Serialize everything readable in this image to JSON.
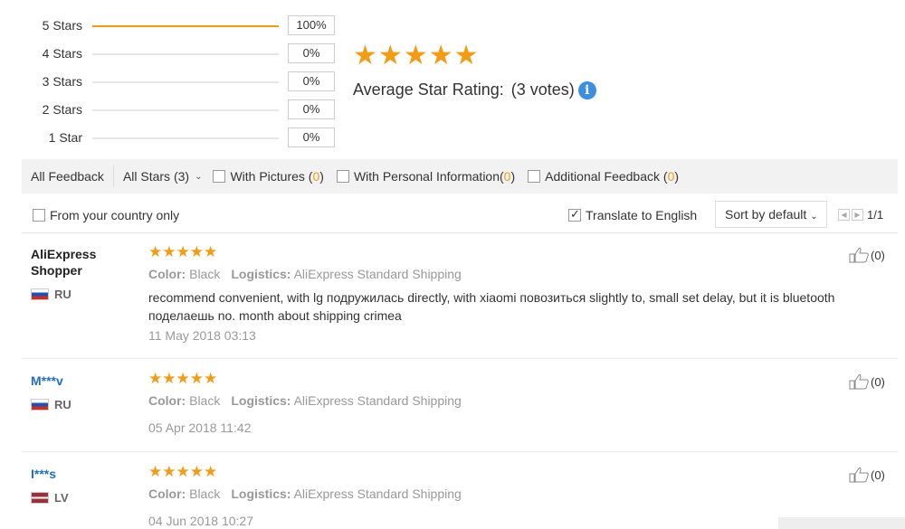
{
  "histogram": [
    {
      "label": "5 Stars",
      "percent": "100%",
      "fraction": 1.0
    },
    {
      "label": "4 Stars",
      "percent": "0%",
      "fraction": 0
    },
    {
      "label": "3 Stars",
      "percent": "0%",
      "fraction": 0
    },
    {
      "label": "2 Stars",
      "percent": "0%",
      "fraction": 0
    },
    {
      "label": "1 Star",
      "percent": "0%",
      "fraction": 0
    }
  ],
  "summary": {
    "stars": 5,
    "average_label": "Average Star Rating:",
    "votes": "(3 votes)",
    "info_icon": "info-icon"
  },
  "filters": {
    "all_feedback": "All Feedback",
    "all_stars": "All Stars (3)",
    "with_pictures": "With Pictures (",
    "with_pictures_count": "0",
    "with_personal": "With Personal Information(",
    "with_personal_count": "0",
    "additional": "Additional Feedback (",
    "additional_count": "0",
    "close_paren": ")"
  },
  "options": {
    "country_only": "From your country only",
    "translate": "Translate to English",
    "translate_checked": true,
    "sort": "Sort by default",
    "page": "1/1"
  },
  "reviews": [
    {
      "user": "AliExpress Shopper",
      "user_is_link": false,
      "country": "RU",
      "stars": 5,
      "color_label": "Color:",
      "color": "Black",
      "logistics_label": "Logistics:",
      "logistics": "AliExpress Standard Shipping",
      "text": "recommend convenient, with lg подружилась directly, with xiaomi повозиться slightly to, small set delay, but it is bluetooth поделаешь no. month about shipping crimea",
      "date": "11 May 2018 03:13",
      "likes": "(0)"
    },
    {
      "user": "M***v",
      "user_is_link": true,
      "country": "RU",
      "stars": 5,
      "color_label": "Color:",
      "color": "Black",
      "logistics_label": "Logistics:",
      "logistics": "AliExpress Standard Shipping",
      "text": "",
      "date": "05 Apr 2018 11:42",
      "likes": "(0)"
    },
    {
      "user": "I***s",
      "user_is_link": true,
      "country": "LV",
      "stars": 5,
      "color_label": "Color:",
      "color": "Black",
      "logistics_label": "Logistics:",
      "logistics": "AliExpress Standard Shipping",
      "text": "",
      "date": "04 Jun 2018 10:27",
      "likes": "(0)"
    }
  ],
  "colors": {
    "star": "#f39c12",
    "link": "#1f6fc4",
    "info": "#3b8ee0"
  }
}
